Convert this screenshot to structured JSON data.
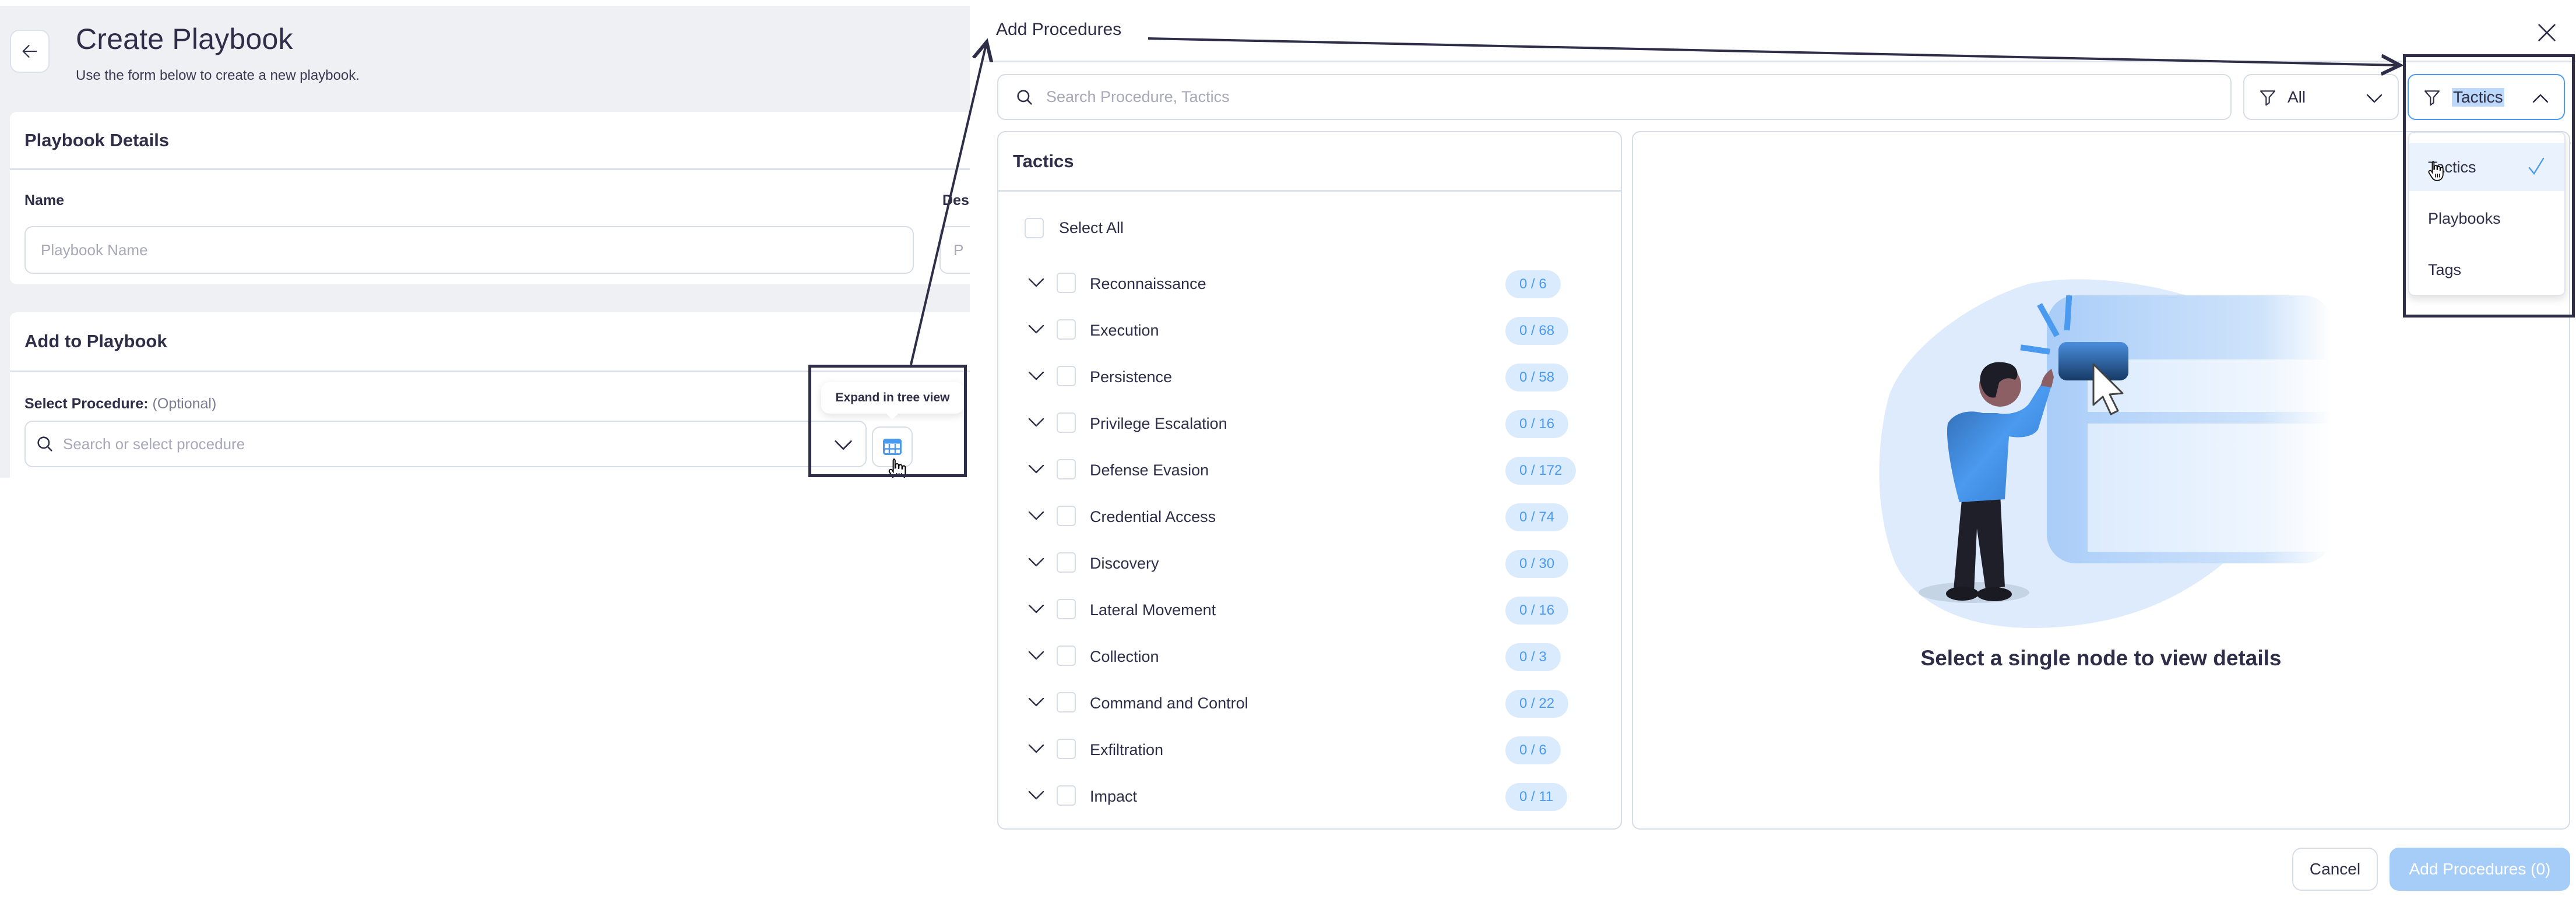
{
  "create_playbook": {
    "back_icon": "arrow-left-icon",
    "title": "Create Playbook",
    "subtitle": "Use the form below to create a new playbook.",
    "details_card": {
      "heading": "Playbook Details",
      "name_label": "Name",
      "name_placeholder": "Playbook Name",
      "description_label_partial": "Des",
      "description_placeholder_partial": "P"
    },
    "add_card": {
      "heading": "Add to Playbook",
      "select_label": "Select Procedure:",
      "select_optional": "(Optional)",
      "select_placeholder": "Search or select procedure",
      "tree_button_icon": "table-tree-icon",
      "tooltip": "Expand in tree view"
    }
  },
  "modal": {
    "title": "Add Procedures",
    "close_icon": "close-icon",
    "search_placeholder": "Search Procedure, Tactics",
    "filter_all": {
      "icon": "filter-icon",
      "value": "All"
    },
    "filter_group": {
      "icon": "filter-icon",
      "value": "Tactics",
      "expanded": true,
      "options": [
        {
          "label": "Tactics",
          "selected": true
        },
        {
          "label": "Playbooks",
          "selected": false
        },
        {
          "label": "Tags",
          "selected": false
        }
      ]
    },
    "tactics_panel": {
      "heading": "Tactics",
      "select_all_label": "Select All",
      "tactics": [
        {
          "name": "Reconnaissance",
          "count": "0 / 6"
        },
        {
          "name": "Execution",
          "count": "0 / 68"
        },
        {
          "name": "Persistence",
          "count": "0 / 58"
        },
        {
          "name": "Privilege Escalation",
          "count": "0 / 16"
        },
        {
          "name": "Defense Evasion",
          "count": "0 / 172"
        },
        {
          "name": "Credential Access",
          "count": "0 / 74"
        },
        {
          "name": "Discovery",
          "count": "0 / 30"
        },
        {
          "name": "Lateral Movement",
          "count": "0 / 16"
        },
        {
          "name": "Collection",
          "count": "0 / 3"
        },
        {
          "name": "Command and Control",
          "count": "0 / 22"
        },
        {
          "name": "Exfiltration",
          "count": "0 / 6"
        },
        {
          "name": "Impact",
          "count": "0 / 11"
        }
      ]
    },
    "details_panel": {
      "illustration": "person-clicking-button-illustration",
      "empty_message": "Select a single node to view details"
    },
    "footer": {
      "cancel_label": "Cancel",
      "add_label": "Add Procedures (0)"
    }
  },
  "colors": {
    "accent": "#4a9af0",
    "badge_bg": "#d9ebfd",
    "primary_disabled": "#a5cdf8",
    "text_dark": "#2e2e48",
    "page_bg": "#eff0f4",
    "border": "#d7dde6",
    "annotation": "#2e2e48"
  }
}
